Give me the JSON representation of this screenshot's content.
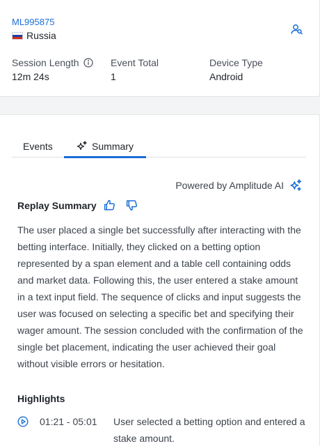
{
  "session": {
    "user_id": "ML995875",
    "country": "Russia",
    "stats": [
      {
        "label": "Session Length",
        "value": "12m 24s",
        "has_info": true
      },
      {
        "label": "Event Total",
        "value": "1",
        "has_info": false
      },
      {
        "label": "Device Type",
        "value": "Android",
        "has_info": false
      }
    ]
  },
  "tabs": [
    {
      "label": "Events",
      "active": false
    },
    {
      "label": "Summary",
      "active": true,
      "icon": "sparkle-icon"
    }
  ],
  "summary": {
    "powered_by": "Powered by Amplitude AI",
    "title": "Replay Summary",
    "text": "The user placed a single bet successfully after interacting with the betting interface. Initially, they clicked on a betting option represented by a span element and a table cell containing odds and market data. Following this, the user entered a stake amount in a text input field. The sequence of clicks and input suggests the user was focused on selecting a specific bet and specifying their wager amount. The session concluded with the confirmation of the single bet placement, indicating the user achieved their goal without visible errors or hesitation."
  },
  "highlights": {
    "title": "Highlights",
    "items": [
      {
        "time": "01:21 - 05:01",
        "text": "User selected a betting option and entered a stake amount."
      }
    ]
  },
  "colors": {
    "accent": "#1a6fd6",
    "flag_white": "#ffffff",
    "flag_blue": "#1c3fa8",
    "flag_red": "#d52b1e"
  }
}
